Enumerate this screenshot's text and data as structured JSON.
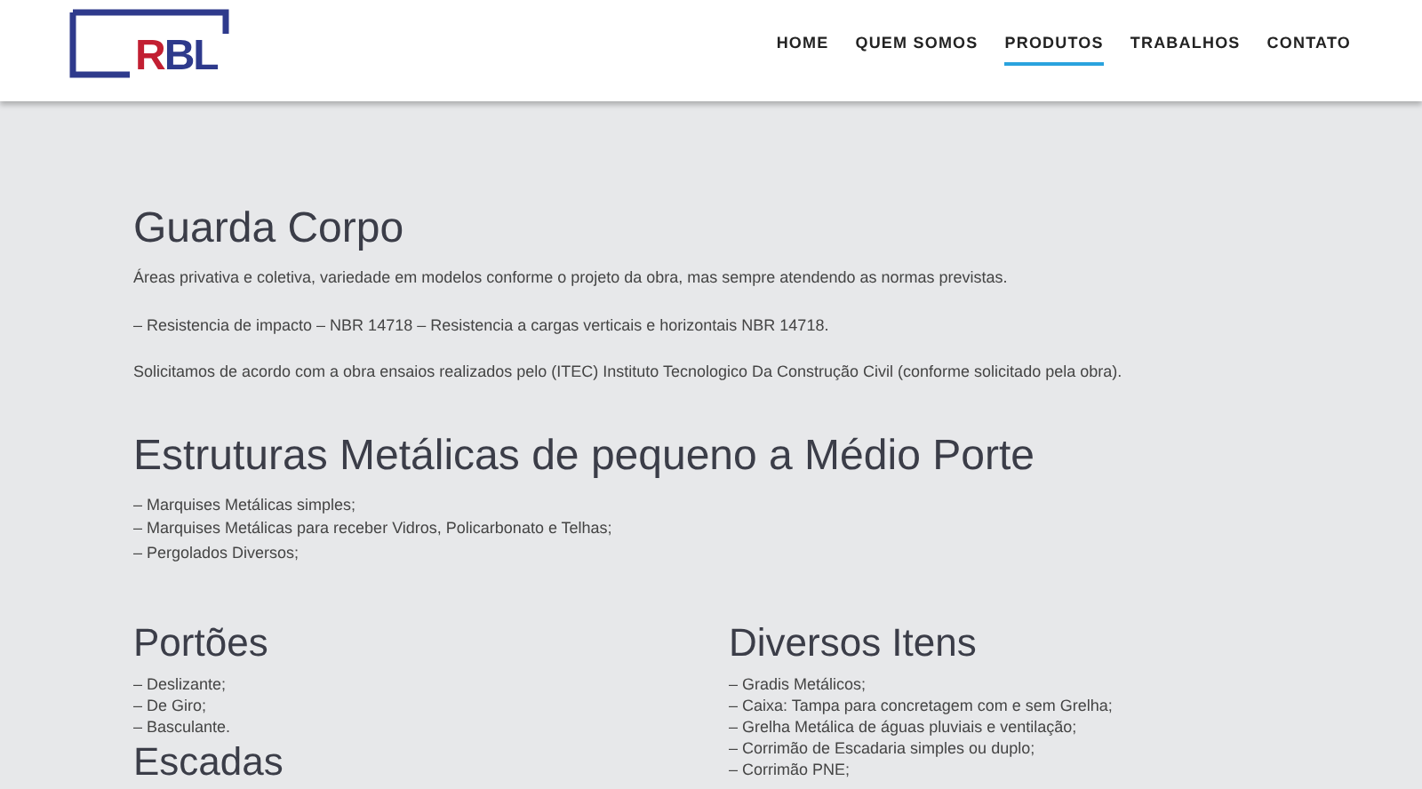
{
  "logo": {
    "parts": [
      {
        "text": "R",
        "color": "#c21f32"
      },
      {
        "text": "BL",
        "color": "#2e3a8c"
      }
    ]
  },
  "nav": [
    {
      "label": "HOME",
      "selected": false
    },
    {
      "label": "QUEM SOMOS",
      "selected": false
    },
    {
      "label": "PRODUTOS",
      "selected": true
    },
    {
      "label": "TRABALHOS",
      "selected": false
    },
    {
      "label": "CONTATO",
      "selected": false
    }
  ],
  "sections": [
    {
      "title": "Guarda Corpo",
      "paragraphs": [
        "Áreas privativa e coletiva, variedade em modelos conforme o projeto da obra, mas sempre atendendo as normas previstas.",
        "– Resistencia de impacto – NBR 14718 – Resistencia a cargas verticais e horizontais NBR 14718.",
        "Solicitamos de acordo com a obra ensaios realizados pelo (ITEC) Instituto Tecnologico Da Construção Civil (conforme solicitado pela obra)."
      ]
    },
    {
      "title": "Estruturas Metálicas de pequeno a Médio Porte",
      "lines": [
        "– Marquises Metálicas simples;",
        "– Marquises Metálicas para receber Vidros, Policarbonato e Telhas;",
        "– Pergolados Diversos;"
      ]
    }
  ],
  "columns": [
    [
      {
        "title": "Portões",
        "lines": [
          "– Deslizante;",
          "– De Giro;",
          "– Basculante."
        ]
      },
      {
        "title": "Escadas"
      }
    ],
    [
      {
        "title": "Diversos Itens",
        "lines": [
          "– Gradis Metálicos;",
          "– Caixa: Tampa para concretagem com e sem Grelha;",
          "– Grelha Metálica de águas pluviais e ventilação;",
          "– Corrimão de Escadaria simples ou duplo;",
          "– Corrimão PNE;"
        ]
      }
    ]
  ]
}
